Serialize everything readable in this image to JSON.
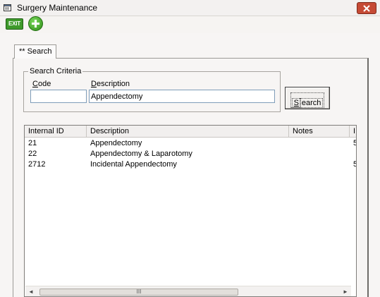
{
  "window": {
    "title": "Surgery Maintenance",
    "app_icon": "form-icon",
    "close_icon": "close-icon"
  },
  "toolbar": {
    "exit_label": "EXIT",
    "add_icon": "plus-icon"
  },
  "tabs": [
    {
      "label": "** Search"
    }
  ],
  "search_criteria": {
    "legend": "Search Criteria",
    "code_label_first": "C",
    "code_label_rest": "ode",
    "description_label_first": "D",
    "description_label_rest": "escription",
    "code_value": "",
    "description_value": "Appendectomy",
    "search_button_first": "S",
    "search_button_rest": "earch"
  },
  "results": {
    "columns": [
      "Internal ID",
      "Description",
      "Notes",
      "I"
    ],
    "rows": [
      {
        "id": "21",
        "description": "Appendectomy",
        "notes": "",
        "extra": "5"
      },
      {
        "id": "22",
        "description": "Appendectomy & Laparotomy",
        "notes": "",
        "extra": ""
      },
      {
        "id": "2712",
        "description": "Incidental Appendectomy",
        "notes": "",
        "extra": "5"
      }
    ],
    "scroll_left": "◄",
    "scroll_right": "►",
    "scroll_grip": "III"
  },
  "colors": {
    "close_button": "#c54a35",
    "exit_button": "#3f9a2b",
    "add_button": "#2c8a16",
    "input_border": "#7f9db9"
  }
}
